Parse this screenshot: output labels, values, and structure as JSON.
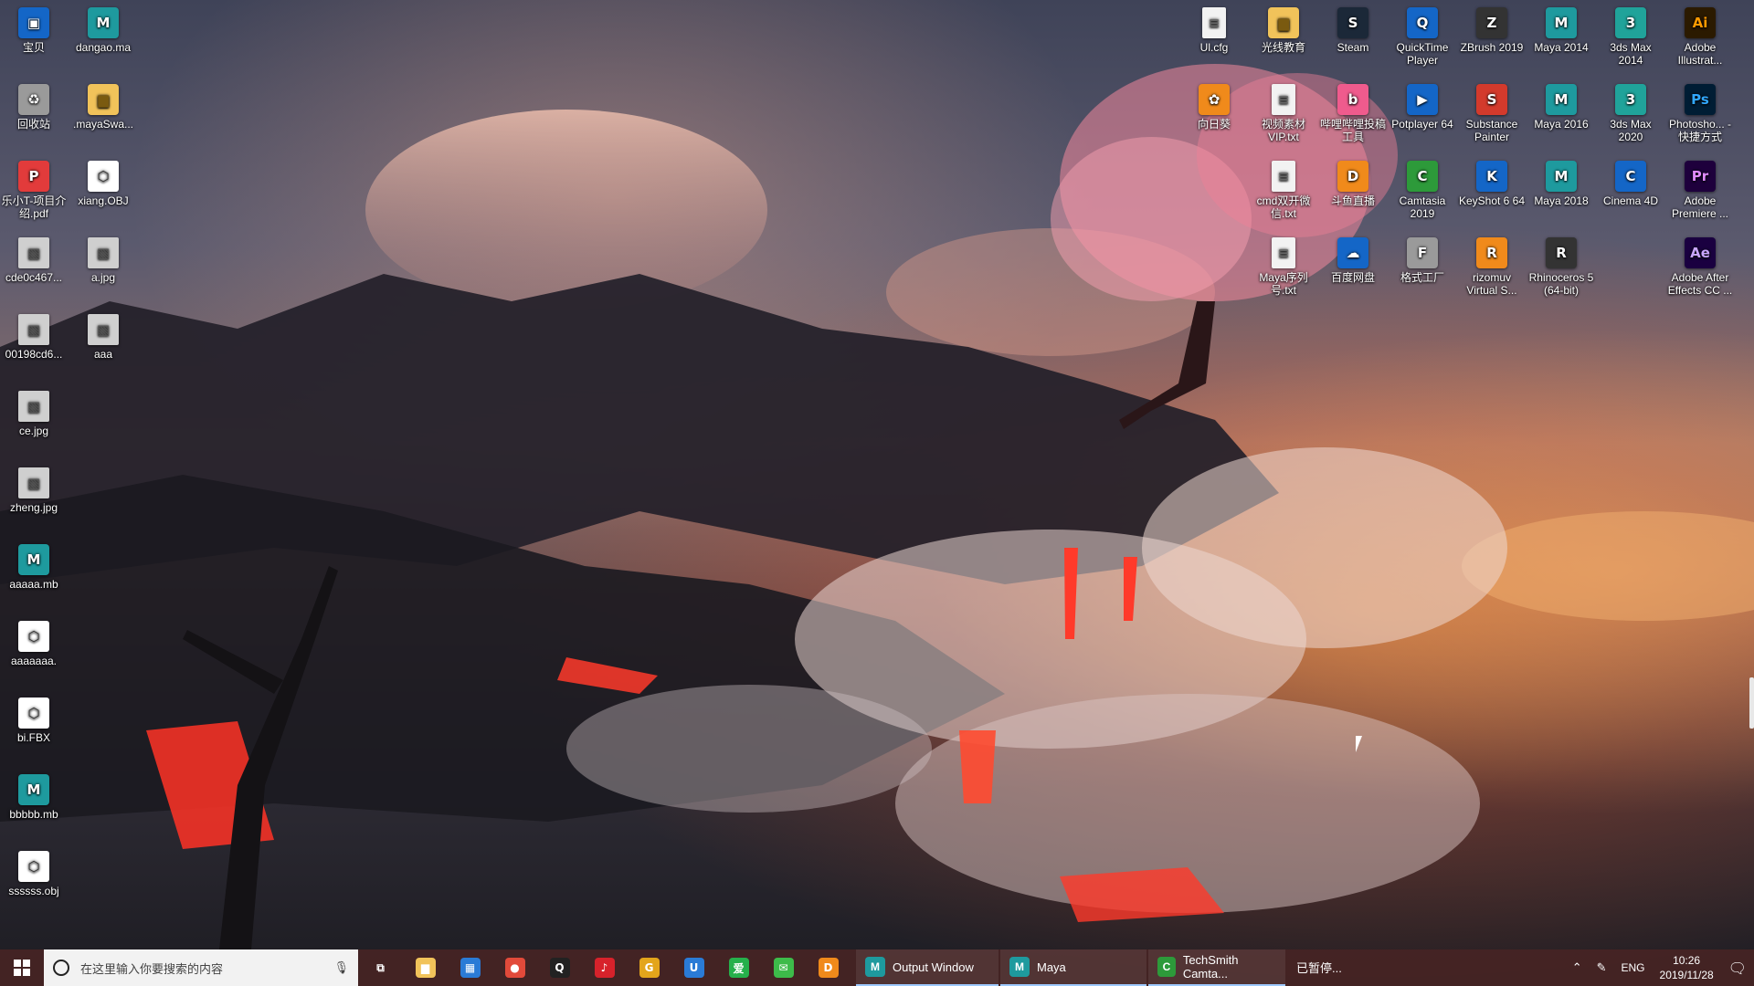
{
  "desktop": {
    "left_column_1": [
      {
        "label": "宝贝",
        "icon": "computer-icon"
      },
      {
        "label": "回收站",
        "icon": "recycle-bin-icon"
      },
      {
        "label": "乐小T-项目介绍.pdf",
        "icon": "pdf-icon"
      },
      {
        "label": "cde0c467...",
        "icon": "image-file-icon"
      },
      {
        "label": "00198cd6...",
        "icon": "image-file-icon"
      },
      {
        "label": "ce.jpg",
        "icon": "image-file-icon"
      },
      {
        "label": "zheng.jpg",
        "icon": "image-file-icon"
      },
      {
        "label": "aaaaa.mb",
        "icon": "maya-file-icon"
      },
      {
        "label": "aaaaaaa.",
        "icon": "3d-object-icon"
      },
      {
        "label": "bi.FBX",
        "icon": "3d-object-icon"
      },
      {
        "label": "bbbbb.mb",
        "icon": "maya-file-icon"
      },
      {
        "label": "ssssss.obj",
        "icon": "3d-object-icon"
      }
    ],
    "left_column_2": [
      {
        "label": "dangao.ma",
        "icon": "maya-file-icon"
      },
      {
        "label": ".mayaSwa...",
        "icon": "folder-icon"
      },
      {
        "label": "xiang.OBJ",
        "icon": "3d-object-icon"
      },
      {
        "label": "a.jpg",
        "icon": "image-file-icon"
      },
      {
        "label": "aaa",
        "icon": "image-file-icon"
      }
    ],
    "right_rows": [
      [
        {
          "label": "Ul.cfg",
          "icon": "file-icon"
        },
        {
          "label": "光线教育",
          "icon": "folder-icon"
        },
        {
          "label": "Steam",
          "icon": "steam-icon"
        },
        {
          "label": "QuickTime Player",
          "icon": "quicktime-icon"
        },
        {
          "label": "ZBrush 2019",
          "icon": "zbrush-icon"
        },
        {
          "label": "Maya 2014",
          "icon": "maya-icon"
        },
        {
          "label": "3ds Max 2014",
          "icon": "3ds-max-icon"
        },
        {
          "label": "Adobe Illustrat...",
          "icon": "illustrator-icon"
        }
      ],
      [
        {
          "label": "向日葵",
          "icon": "sunflower-icon"
        },
        {
          "label": "视频素材 VIP.txt",
          "icon": "text-file-icon"
        },
        {
          "label": "哔哩哔哩投稿工具",
          "icon": "bilibili-icon"
        },
        {
          "label": "Potplayer 64",
          "icon": "potplayer-icon"
        },
        {
          "label": "Substance Painter",
          "icon": "substance-painter-icon"
        },
        {
          "label": "Maya 2016",
          "icon": "maya-icon"
        },
        {
          "label": "3ds Max 2020",
          "icon": "3ds-max-icon"
        },
        {
          "label": "Photosho... - 快捷方式",
          "icon": "photoshop-icon"
        }
      ],
      [
        {
          "label": "",
          "icon": "empty"
        },
        {
          "label": "cmd双开微信.txt",
          "icon": "text-file-icon"
        },
        {
          "label": "斗鱼直播",
          "icon": "douyu-icon"
        },
        {
          "label": "Camtasia 2019",
          "icon": "camtasia-icon"
        },
        {
          "label": "KeyShot 6 64",
          "icon": "keyshot-icon"
        },
        {
          "label": "Maya 2018",
          "icon": "maya-icon"
        },
        {
          "label": "Cinema 4D",
          "icon": "cinema4d-icon"
        },
        {
          "label": "Adobe Premiere ...",
          "icon": "premiere-icon"
        }
      ],
      [
        {
          "label": "",
          "icon": "empty"
        },
        {
          "label": "Maya序列号.txt",
          "icon": "text-file-icon"
        },
        {
          "label": "百度网盘",
          "icon": "baidu-netdisk-icon"
        },
        {
          "label": "格式工厂",
          "icon": "format-factory-icon"
        },
        {
          "label": "rizomuv Virtual S...",
          "icon": "rizomuv-icon"
        },
        {
          "label": "Rhinoceros 5 (64-bit)",
          "icon": "rhino-icon"
        },
        {
          "label": "",
          "icon": "empty"
        },
        {
          "label": "Adobe After Effects CC ...",
          "icon": "after-effects-icon"
        }
      ]
    ]
  },
  "taskbar": {
    "search_placeholder": "在这里输入你要搜索的内容",
    "pinned": [
      {
        "name": "task-view-icon",
        "glyph": "⧉",
        "color": "transparent"
      },
      {
        "name": "file-explorer-icon",
        "glyph": "▆",
        "color": "#f1c35a"
      },
      {
        "name": "store-icon",
        "glyph": "▦",
        "color": "#2a7bd6"
      },
      {
        "name": "chrome-icon",
        "glyph": "●",
        "color": "#e24a3a"
      },
      {
        "name": "qq-icon",
        "glyph": "Q",
        "color": "#222"
      },
      {
        "name": "netease-music-icon",
        "glyph": "♪",
        "color": "#d7222b"
      },
      {
        "name": "g-app-icon",
        "glyph": "G",
        "color": "#e3a51b"
      },
      {
        "name": "u-app-icon",
        "glyph": "U",
        "color": "#2a7bd6"
      },
      {
        "name": "iqiyi-icon",
        "glyph": "爱",
        "color": "#26b04b"
      },
      {
        "name": "wechat-icon",
        "glyph": "✉",
        "color": "#3dbb4a"
      },
      {
        "name": "douyu-taskbar-icon",
        "glyph": "D",
        "color": "#f08a1b"
      }
    ],
    "apps": [
      {
        "label": "Output Window",
        "color": "#1e9a9e",
        "glyph": "M",
        "active": true
      },
      {
        "label": "Maya",
        "color": "#1e9a9e",
        "glyph": "M",
        "active": true
      },
      {
        "label": "TechSmith Camta...",
        "color": "#2d9a3a",
        "glyph": "C",
        "active": true
      },
      {
        "label": "已暂停...",
        "color": "transparent",
        "glyph": "",
        "active": false
      }
    ],
    "tray": {
      "language": "ENG",
      "time": "10:26",
      "date": "2019/11/28"
    }
  }
}
